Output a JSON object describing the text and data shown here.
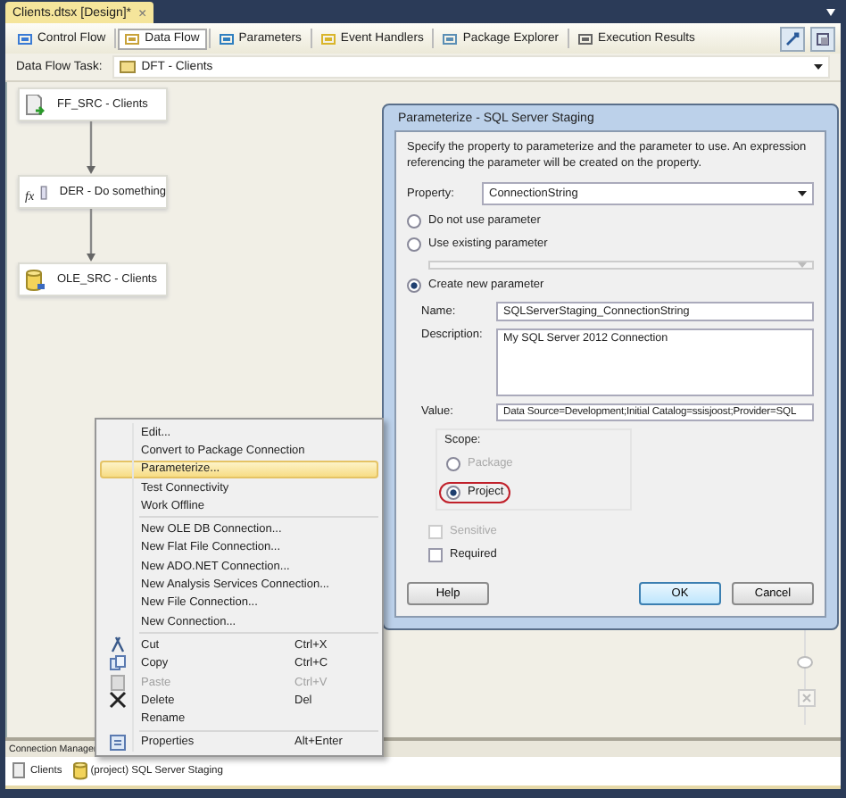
{
  "document_tab": {
    "title": "Clients.dtsx [Design]*",
    "close": "×"
  },
  "designer_tabs": [
    {
      "label": "Control Flow",
      "selected": false
    },
    {
      "label": "Data Flow",
      "selected": true
    },
    {
      "label": "Parameters",
      "selected": false
    },
    {
      "label": "Event Handlers",
      "selected": false
    },
    {
      "label": "Package Explorer",
      "selected": false
    },
    {
      "label": "Execution Results",
      "selected": false
    }
  ],
  "task_selector": {
    "label": "Data Flow Task:",
    "value": "DFT - Clients"
  },
  "nodes": [
    {
      "label": "FF_SRC - Clients",
      "kind": "flatfile"
    },
    {
      "label": "DER - Do something",
      "kind": "derived",
      "icon_label": "fx"
    },
    {
      "label": "OLE_SRC - Clients",
      "kind": "database"
    }
  ],
  "dialog": {
    "title": "Parameterize - SQL Server Staging",
    "instruction": "Specify the property to parameterize and the parameter to use. An expression referencing the parameter will be created on the property.",
    "property": {
      "label": "Property:",
      "value": "ConnectionString"
    },
    "modes": [
      {
        "label": "Do not use parameter",
        "selected": false
      },
      {
        "label": "Use existing parameter",
        "selected": false
      },
      {
        "label": "Create new parameter",
        "selected": true
      }
    ],
    "fields": [
      {
        "label": "Name:",
        "value": "SQLServerStaging_ConnectionString",
        "kind": "line"
      },
      {
        "label": "Description:",
        "value": "My SQL Server 2012 Connection",
        "kind": "area"
      },
      {
        "label": "Value:",
        "value": "Data Source=Development;Initial Catalog=ssisjoost;Provider=SQL",
        "kind": "line"
      }
    ],
    "scope": {
      "label": "Scope:",
      "options": [
        {
          "label": "Package",
          "selected": false,
          "disabled": true,
          "highlighted": false
        },
        {
          "label": "Project",
          "selected": true,
          "disabled": false,
          "highlighted": true
        }
      ]
    },
    "checkboxes": [
      {
        "label": "Sensitive",
        "checked": false,
        "disabled": true
      },
      {
        "label": "Required",
        "checked": false,
        "disabled": false
      }
    ],
    "buttons": [
      {
        "label": "Help",
        "default": false
      },
      {
        "label": "OK",
        "default": true
      },
      {
        "label": "Cancel",
        "default": false
      }
    ]
  },
  "context_menu": {
    "groups": [
      [
        {
          "label": "Edit...",
          "selected": false,
          "disabled": false,
          "kind": "plain"
        },
        {
          "label": "Convert to Package Connection",
          "selected": false,
          "disabled": false,
          "kind": "plain"
        },
        {
          "label": "Parameterize...",
          "selected": true,
          "disabled": false,
          "kind": "plain"
        },
        {
          "label": "Test Connectivity",
          "selected": false,
          "disabled": false,
          "kind": "plain"
        },
        {
          "label": "Work Offline",
          "selected": false,
          "disabled": false,
          "kind": "plain"
        }
      ],
      [
        {
          "label": "New OLE DB Connection...",
          "selected": false,
          "disabled": false,
          "kind": "plain"
        },
        {
          "label": "New Flat File Connection...",
          "selected": false,
          "disabled": false,
          "kind": "plain"
        },
        {
          "label": "New ADO.NET Connection...",
          "selected": false,
          "disabled": false,
          "kind": "plain"
        },
        {
          "label": "New Analysis Services Connection...",
          "selected": false,
          "disabled": false,
          "kind": "plain"
        },
        {
          "label": "New File Connection...",
          "selected": false,
          "disabled": false,
          "kind": "plain"
        },
        {
          "label": "New Connection...",
          "selected": false,
          "disabled": false,
          "kind": "plain"
        }
      ],
      [
        {
          "label": "Cut",
          "shortcut": "Ctrl+X",
          "selected": false,
          "disabled": false,
          "kind": "cut"
        },
        {
          "label": "Copy",
          "shortcut": "Ctrl+C",
          "selected": false,
          "disabled": false,
          "kind": "copy"
        },
        {
          "label": "Paste",
          "shortcut": "Ctrl+V",
          "selected": false,
          "disabled": true,
          "kind": "paste"
        },
        {
          "label": "Delete",
          "shortcut": "Del",
          "selected": false,
          "disabled": false,
          "kind": "delete"
        },
        {
          "label": "Rename",
          "selected": false,
          "disabled": false,
          "kind": "plain"
        }
      ],
      [
        {
          "label": "Properties",
          "shortcut": "Alt+Enter",
          "selected": false,
          "disabled": false,
          "kind": "properties"
        }
      ]
    ]
  },
  "connection_managers": {
    "title": "Connection Manager",
    "items": [
      {
        "label": "Clients",
        "kind": "file"
      },
      {
        "label": "(project) SQL Server Staging",
        "kind": "database"
      }
    ]
  }
}
